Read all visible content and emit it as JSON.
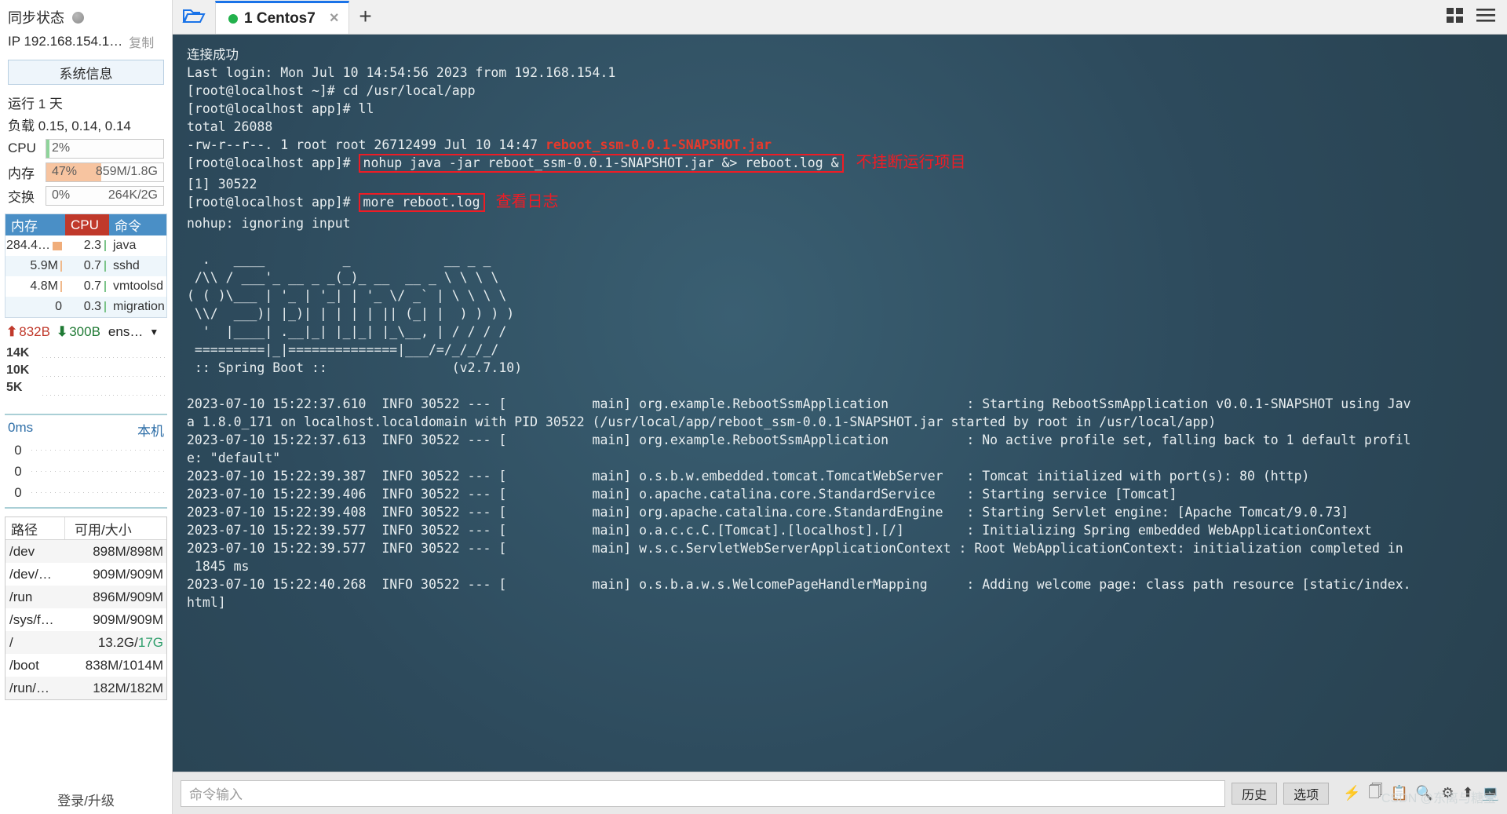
{
  "sidebar": {
    "sync": {
      "label": "同步状态",
      "icon": "status-dot"
    },
    "ip": {
      "label": "IP 192.168.154.1…",
      "copy": "复制"
    },
    "sysinfo_button": "系统信息",
    "uptime": "运行 1 天",
    "load": "负载 0.15, 0.14, 0.14",
    "meters": [
      {
        "name": "CPU",
        "left": "2%",
        "right": "",
        "percent": 2,
        "color": "#8fd49b"
      },
      {
        "name": "内存",
        "left": "47%",
        "right": "859M/1.8G",
        "percent": 47,
        "color": "#f7c4a0"
      },
      {
        "name": "交换",
        "left": "0%",
        "right": "264K/2G",
        "percent": 0,
        "color": "#cccccc"
      }
    ],
    "process_table": {
      "headers": {
        "mem": "内存",
        "cpu": "CPU",
        "cmd": "命令"
      },
      "rows": [
        {
          "mem": "284.4…",
          "cpu": "2.3",
          "cmd": "java"
        },
        {
          "mem": "5.9M",
          "cpu": "0.7",
          "cmd": "sshd"
        },
        {
          "mem": "4.8M",
          "cpu": "0.7",
          "cmd": "vmtoolsd"
        },
        {
          "mem": "0",
          "cpu": "0.3",
          "cmd": "migration"
        }
      ]
    },
    "network": {
      "up": "832B",
      "down": "300B",
      "interface": "ens…",
      "y_labels": [
        "14K",
        "10K",
        "5K"
      ]
    },
    "latency": {
      "value": "0ms",
      "target": "本机",
      "rows": [
        "0",
        "0",
        "0"
      ]
    },
    "disk_table": {
      "headers": {
        "path": "路径",
        "size": "可用/大小"
      },
      "rows": [
        {
          "path": "/dev",
          "size": "898M/898M",
          "hl": ""
        },
        {
          "path": "/dev/…",
          "size": "909M/909M",
          "hl": ""
        },
        {
          "path": "/run",
          "size": "896M/909M",
          "hl": ""
        },
        {
          "path": "/sys/f…",
          "size": "909M/909M",
          "hl": ""
        },
        {
          "path": "/",
          "size": "13.2G/",
          "hl": "17G"
        },
        {
          "path": "/boot",
          "size": "838M/1014M",
          "hl": ""
        },
        {
          "path": "/run/…",
          "size": "182M/182M",
          "hl": ""
        }
      ]
    },
    "login_upgrade": "登录/升级"
  },
  "tabbar": {
    "folder_icon": "folder-open-icon",
    "tab_label": "1 Centos7",
    "tab_close": "×",
    "tab_add": "+",
    "grid_icon": "grid-view-icon",
    "menu_icon": "hamburger-menu-icon"
  },
  "terminal": {
    "connect_msg": "连接成功",
    "lines": [
      "Last login: Mon Jul 10 14:54:56 2023 from 192.168.154.1",
      "[root@localhost ~]# cd /usr/local/app",
      "[root@localhost app]# ll",
      "total 26088"
    ],
    "ls_line_prefix": "-rw-r--r--. 1 root root 26712499 Jul 10 14:47 ",
    "ls_line_file": "reboot_ssm-0.0.1-SNAPSHOT.jar",
    "cmd1_prompt": "[root@localhost app]# ",
    "cmd1_boxed": "nohup java -jar reboot_ssm-0.0.1-SNAPSHOT.jar &> reboot.log &",
    "cmd1_anno": "不挂断运行项目",
    "job_line": "[1] 30522",
    "cmd2_prompt": "[root@localhost app]# ",
    "cmd2_boxed": "more reboot.log",
    "cmd2_anno": "查看日志",
    "nohup_line": "nohup: ignoring input",
    "banner": [
      "  .   ____          _            __ _ _",
      " /\\\\ / ___'_ __ _ _(_)_ __  __ _ \\ \\ \\ \\",
      "( ( )\\___ | '_ | '_| | '_ \\/ _` | \\ \\ \\ \\",
      " \\\\/  ___)| |_)| | | | | || (_| |  ) ) ) )",
      "  '  |____| .__|_| |_|_| |_\\__, | / / / /",
      " =========|_|==============|___/=/_/_/_/"
    ],
    "spring_line": " :: Spring Boot ::                (v2.7.10)",
    "log_lines": [
      "2023-07-10 15:22:37.610  INFO 30522 --- [           main] org.example.RebootSsmApplication          : Starting RebootSsmApplication v0.0.1-SNAPSHOT using Jav",
      "a 1.8.0_171 on localhost.localdomain with PID 30522 (/usr/local/app/reboot_ssm-0.0.1-SNAPSHOT.jar started by root in /usr/local/app)",
      "2023-07-10 15:22:37.613  INFO 30522 --- [           main] org.example.RebootSsmApplication          : No active profile set, falling back to 1 default profil",
      "e: \"default\"",
      "2023-07-10 15:22:39.387  INFO 30522 --- [           main] o.s.b.w.embedded.tomcat.TomcatWebServer   : Tomcat initialized with port(s): 80 (http)",
      "2023-07-10 15:22:39.406  INFO 30522 --- [           main] o.apache.catalina.core.StandardService    : Starting service [Tomcat]",
      "2023-07-10 15:22:39.408  INFO 30522 --- [           main] org.apache.catalina.core.StandardEngine   : Starting Servlet engine: [Apache Tomcat/9.0.73]",
      "2023-07-10 15:22:39.577  INFO 30522 --- [           main] o.a.c.c.C.[Tomcat].[localhost].[/]        : Initializing Spring embedded WebApplicationContext",
      "2023-07-10 15:22:39.577  INFO 30522 --- [           main] w.s.c.ServletWebServerApplicationContext : Root WebApplicationContext: initialization completed in",
      " 1845 ms",
      "2023-07-10 15:22:40.268  INFO 30522 --- [           main] o.s.b.a.w.s.WelcomePageHandlerMapping     : Adding welcome page: class path resource [static/index.",
      "html]"
    ],
    "watermark": "CSDN @东离与糖宝"
  },
  "cmdbar": {
    "input_placeholder": "命令输入",
    "history_button": "历史",
    "options_button": "选项",
    "icons": [
      "bolt-icon",
      "copy-icon",
      "clipboard-icon",
      "search-icon",
      "gear-icon",
      "up-arrow-icon",
      "monitor-icon"
    ]
  },
  "colors": {
    "accent": "#1a73e8",
    "terminal_bg": "#2d4a5c",
    "annotation_red": "#ee1c25",
    "tab_status_green": "#22b14c"
  }
}
